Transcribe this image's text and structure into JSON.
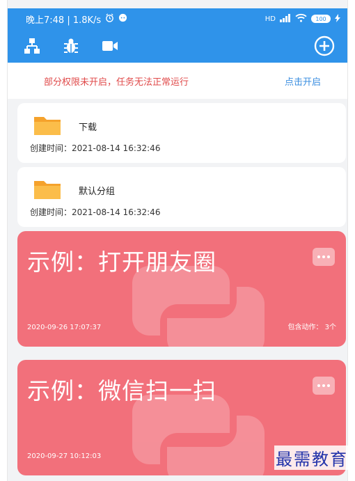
{
  "status_bar": {
    "time_speed": "晚上7:48 | 1.8K/s",
    "network_label": "HD",
    "battery_label": "100"
  },
  "toolbar": {
    "icons": [
      "network-icon",
      "bug-icon",
      "video-camera-icon",
      "add-circle-icon"
    ]
  },
  "notice": {
    "message": "部分权限未开启，任务无法正常运行",
    "action": "点击开启"
  },
  "groups": [
    {
      "name": "下载",
      "created": "创建时间：2021-08-14 16:32:46"
    },
    {
      "name": "默认分组",
      "created": "创建时间：2021-08-14 16:32:46"
    }
  ],
  "tasks": [
    {
      "title": "示例：打开朋友圈",
      "date": "2020-09-26 17:07:37",
      "actions": "包含动作：  3个"
    },
    {
      "title": "示例：微信扫一扫",
      "date": "2020-09-27 10:12:03",
      "actions": ""
    }
  ],
  "watermark": "最需教育",
  "colors": {
    "primary": "#2f93ea",
    "task_card": "#f2707b",
    "folder": "#f7a93b",
    "warning": "#e04a4a",
    "link": "#3a8ee0"
  }
}
